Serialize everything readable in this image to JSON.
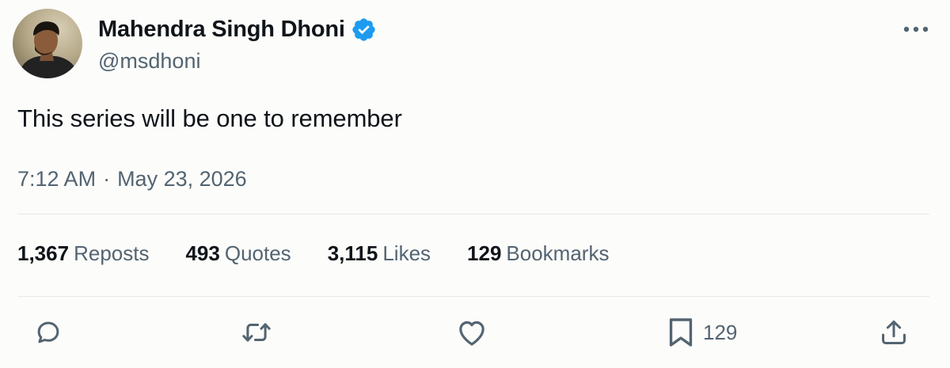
{
  "author": {
    "display_name": "Mahendra Singh Dhoni",
    "handle": "@msdhoni",
    "verified": true
  },
  "tweet": {
    "text": "This series will be one to remember",
    "time": "7:12 AM",
    "separator": "·",
    "date": "May 23, 2026"
  },
  "stats": [
    {
      "value": "1,367",
      "label": "Reposts"
    },
    {
      "value": "493",
      "label": "Quotes"
    },
    {
      "value": "3,115",
      "label": "Likes"
    },
    {
      "value": "129",
      "label": "Bookmarks"
    }
  ],
  "actions": {
    "reply": {
      "icon": "reply-icon"
    },
    "repost": {
      "icon": "repost-icon"
    },
    "like": {
      "icon": "heart-icon"
    },
    "bookmark": {
      "icon": "bookmark-icon",
      "count": "129"
    },
    "share": {
      "icon": "share-icon"
    }
  },
  "colors": {
    "background": "#fcfcfa",
    "text_primary": "#0f1419",
    "text_secondary": "#536471",
    "verified_blue": "#1d9bf0",
    "divider": "#e6e9ec"
  }
}
